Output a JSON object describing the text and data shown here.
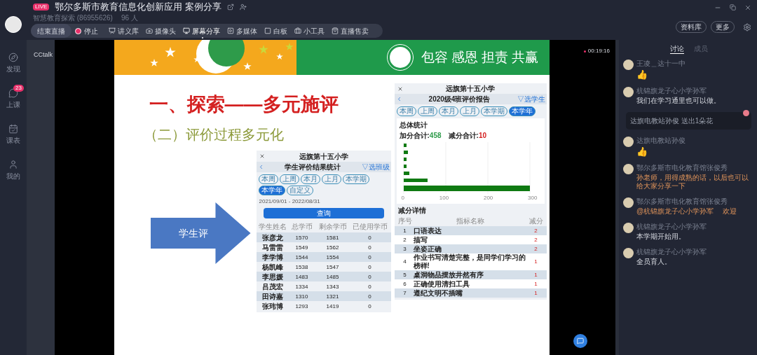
{
  "header": {
    "live_badge": "LIVE",
    "title": "鄂尔多斯市教育信息化创新应用 案例分享",
    "channel": "智慧教育探索 (86955626)",
    "viewers": "96 人"
  },
  "toolbar": {
    "end_button": "结束直播",
    "record": {
      "label": "停止",
      "on": true
    },
    "tools": [
      {
        "kind": "slides",
        "label": "讲义库",
        "selected": false
      },
      {
        "kind": "camera",
        "label": "摄像头",
        "selected": false
      },
      {
        "kind": "screen",
        "label": "屏幕分享",
        "selected": true
      },
      {
        "kind": "media",
        "label": "多媒体",
        "selected": false
      },
      {
        "kind": "board",
        "label": "白板",
        "selected": false
      },
      {
        "kind": "tools",
        "label": "小工具",
        "selected": false
      },
      {
        "kind": "shop",
        "label": "直播售卖",
        "selected": false
      }
    ],
    "right_buttons": [
      "资料库",
      "更多"
    ]
  },
  "nav": [
    {
      "kind": "discover",
      "label": "发现"
    },
    {
      "kind": "class",
      "label": "上课",
      "badge": "23"
    },
    {
      "kind": "schedule",
      "label": "课表"
    },
    {
      "kind": "me",
      "label": "我的"
    }
  ],
  "app_name": "CCtalk",
  "timer": "00:19:16",
  "slide": {
    "motto": "包容 感恩 担责 共赢",
    "heading": "一、探索——多元施评",
    "subheading": "（二）评价过程多元化",
    "arrow_label": "学生评",
    "phone_left": {
      "school": "远旗第十五小学",
      "title": "学生评价结果统计",
      "picker": "▽选班级",
      "periods": [
        {
          "label": "本周",
          "selected": false
        },
        {
          "label": "上周",
          "selected": false
        },
        {
          "label": "本月",
          "selected": false
        },
        {
          "label": "上月",
          "selected": false
        },
        {
          "label": "本学期",
          "selected": false
        },
        {
          "label": "本学年",
          "selected": true
        },
        {
          "label": "自定义",
          "selected": false
        }
      ],
      "dates": "2021/09/01 - 2022/08/31",
      "query": "查询",
      "columns": [
        "学生姓名",
        "总学币",
        "剩余学币",
        "已使用学币"
      ],
      "rows": [
        [
          "张彦龙",
          "1570",
          "1581",
          "0"
        ],
        [
          "马雷雷",
          "1549",
          "1562",
          "0"
        ],
        [
          "李学博",
          "1544",
          "1554",
          "0"
        ],
        [
          "杨凯峰",
          "1538",
          "1547",
          "0"
        ],
        [
          "李思媛",
          "1483",
          "1485",
          "0"
        ],
        [
          "吕茂宏",
          "1334",
          "1343",
          "0"
        ],
        [
          "田诗嘉",
          "1310",
          "1321",
          "0"
        ],
        [
          "张玮博",
          "1293",
          "1419",
          "0"
        ]
      ]
    },
    "phone_right": {
      "school": "远旗第十五小学",
      "title": "2020级4班评价报告",
      "picker": "▽选学生",
      "periods": [
        {
          "label": "本周",
          "selected": false
        },
        {
          "label": "上周",
          "selected": false
        },
        {
          "label": "本月",
          "selected": false
        },
        {
          "label": "上月",
          "selected": false
        },
        {
          "label": "本学期",
          "selected": false
        },
        {
          "label": "本学年",
          "selected": true
        }
      ],
      "overall": "总体统计",
      "plus_label": "加分合计:",
      "plus": "458",
      "minus_label": "减分合计:",
      "minus": "10",
      "ticks": [
        "0",
        "100",
        "200",
        "300"
      ],
      "detail_title": "减分详情",
      "columns": [
        "序号",
        "指标名称",
        "减分"
      ],
      "rows": [
        [
          "1",
          "口语表达",
          "2"
        ],
        [
          "2",
          "描写",
          "2"
        ],
        [
          "3",
          "坐姿正确",
          "2"
        ],
        [
          "4",
          "作业书写清楚完整，是同学们学习的榜样!",
          "1"
        ],
        [
          "5",
          "桌洞物品摆放井然有序",
          "1"
        ],
        [
          "6",
          "正确使用清扫工具",
          "1"
        ],
        [
          "7",
          "遵纪文明不插嘴",
          "1"
        ]
      ]
    }
  },
  "chat": {
    "tabs": [
      {
        "label": "讨论",
        "selected": true
      },
      {
        "label": "成员",
        "selected": false
      }
    ],
    "messages": [
      {
        "kind": "sticker",
        "author": "王凌＿达十一中",
        "text": "👍"
      },
      {
        "kind": "message",
        "author": "杭锦旗龙子心小学孙军",
        "text": "我们在学习通里也可以做。",
        "highlight": false
      },
      {
        "kind": "gift",
        "text": "达旗电教站孙俊 送出1朵花"
      },
      {
        "kind": "sticker",
        "author": "达旗电教站孙俊",
        "text": "👍"
      },
      {
        "kind": "message",
        "author": "鄂尔多斯市电化教育馆张俊秀",
        "text": "孙老师，用得成熟的话，以后也可以给大家分享一下",
        "highlight": true
      },
      {
        "kind": "message",
        "author": "鄂尔多斯市电化教育馆张俊秀",
        "text": "@杭锦旗龙子心小学孙军　 欢迎",
        "highlight": true
      },
      {
        "kind": "message",
        "author": "杭锦旗龙子心小学孙军",
        "text": "本学期开始用。",
        "highlight": false
      },
      {
        "kind": "message",
        "author": "杭锦旗龙子心小学孙军",
        "text": "全员育人。",
        "highlight": false
      }
    ]
  }
}
